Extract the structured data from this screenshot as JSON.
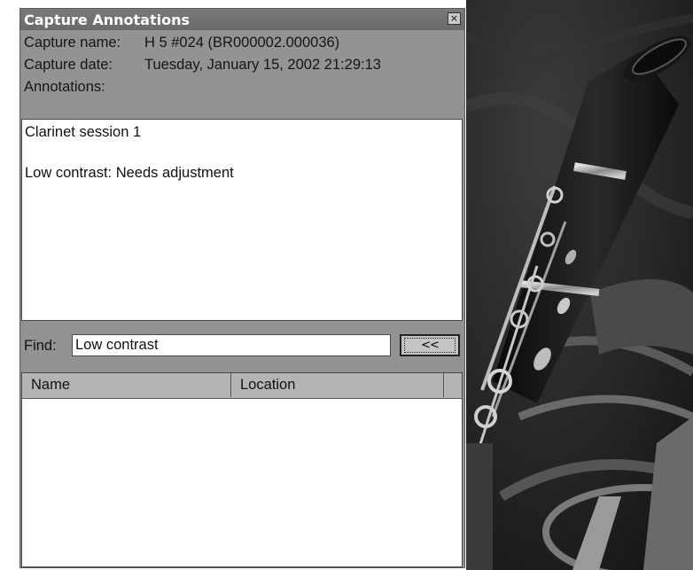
{
  "window": {
    "title": "Capture Annotations",
    "close_glyph": "×"
  },
  "capture": {
    "name_label": "Capture name:",
    "name_value": "H 5 #024 (BR000002.000036)",
    "date_label": "Capture date:",
    "date_value": "Tuesday, January 15, 2002 21:29:13",
    "annotations_label": "Annotations:"
  },
  "annotations": {
    "lines": [
      "Clarinet session 1",
      "",
      "Low contrast: Needs adjustment"
    ]
  },
  "find": {
    "label": "Find:",
    "value": "Low contrast",
    "button_label": "<<"
  },
  "results": {
    "columns": [
      "Name",
      "Location"
    ],
    "rows": []
  },
  "photo": {
    "subject": "clarinet and horn photograph"
  },
  "colors": {
    "window_bg": "#939393",
    "titlebar": "#6e6e6e",
    "panel_white": "#ffffff"
  }
}
